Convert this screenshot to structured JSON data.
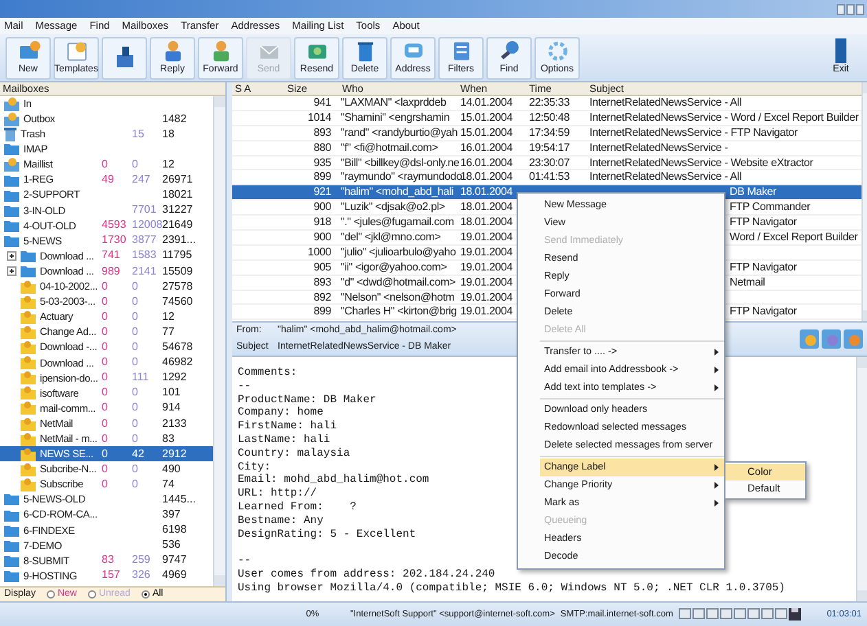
{
  "menu_bar": [
    "Mail",
    "Message",
    "Find",
    "Mailboxes",
    "Transfer",
    "Addresses",
    "Mailing List",
    "Tools",
    "About"
  ],
  "toolbar": [
    {
      "label": "New",
      "disabled": false
    },
    {
      "label": "Templates",
      "disabled": false
    },
    {
      "disabled": false
    },
    {
      "label": "Reply",
      "disabled": false
    },
    {
      "label": "Forward",
      "disabled": false
    },
    {
      "label": "Send",
      "disabled": true
    },
    {
      "label": "Resend",
      "disabled": false
    },
    {
      "label": "Delete",
      "disabled": false
    },
    {
      "label": "Address",
      "disabled": false
    },
    {
      "label": "Filters",
      "disabled": false
    },
    {
      "label": "Find",
      "disabled": false
    },
    {
      "label": "Options",
      "disabled": false
    }
  ],
  "exit_button": "Exit",
  "mailboxes": {
    "header": "Mailboxes",
    "items": [
      {
        "name": "In",
        "kind": "special",
        "selected": false
      },
      {
        "name": "Outbox",
        "kind": "special",
        "total": "1482",
        "selected": false
      },
      {
        "name": "Trash",
        "kind": "trash",
        "unread": "15",
        "total": "18",
        "selected": false
      },
      {
        "name": "IMAP",
        "kind": "folder",
        "selected": false
      },
      {
        "name": "Maillist",
        "kind": "special",
        "new": "0",
        "unread": "0",
        "total": "12",
        "selected": false
      },
      {
        "name": "1-REG",
        "kind": "folder",
        "new": "49",
        "unread": "247",
        "total": "26971",
        "selected": false
      },
      {
        "name": "2-SUPPORT",
        "kind": "folder",
        "total": "18021",
        "selected": false
      },
      {
        "name": "3-IN-OLD",
        "kind": "folder",
        "unread": "7701",
        "total": "31227",
        "selected": false
      },
      {
        "name": "4-OUT-OLD",
        "kind": "folder",
        "new": "4593",
        "unread": "12008",
        "total": "21649",
        "selected": false
      },
      {
        "name": "5-NEWS",
        "kind": "folder",
        "new": "1730",
        "unread": "3877",
        "total": "2391...",
        "selected": false,
        "children": [
          {
            "name": "Download ...",
            "kind": "folder",
            "new": "741",
            "unread": "1583",
            "total": "11795",
            "selected": false,
            "expanded": false
          },
          {
            "name": "Download ...",
            "kind": "folder",
            "new": "989",
            "unread": "2141",
            "total": "15509",
            "selected": false,
            "expanded": false
          },
          {
            "name": "04-10-2002...",
            "kind": "group",
            "new": "0",
            "unread": "0",
            "total": "27578",
            "selected": false
          },
          {
            "name": "5-03-2003-...",
            "kind": "group",
            "new": "0",
            "unread": "0",
            "total": "74560",
            "selected": false
          },
          {
            "name": "Actuary",
            "kind": "group",
            "new": "0",
            "unread": "0",
            "total": "12",
            "selected": false
          },
          {
            "name": "Change Ad...",
            "kind": "group",
            "new": "0",
            "unread": "0",
            "total": "77",
            "selected": false
          },
          {
            "name": "Download -...",
            "kind": "group",
            "new": "0",
            "unread": "0",
            "total": "54678",
            "selected": false
          },
          {
            "name": "Download ...",
            "kind": "group",
            "new": "0",
            "unread": "0",
            "total": "46982",
            "selected": false
          },
          {
            "name": "ipension-do...",
            "kind": "group",
            "new": "0",
            "unread": "111",
            "total": "1292",
            "selected": false
          },
          {
            "name": "isoftware",
            "kind": "group",
            "new": "0",
            "unread": "0",
            "total": "101",
            "selected": false
          },
          {
            "name": "mail-comm...",
            "kind": "group",
            "new": "0",
            "unread": "0",
            "total": "914",
            "selected": false
          },
          {
            "name": "NetMail",
            "kind": "group",
            "new": "0",
            "unread": "0",
            "total": "2133",
            "selected": false
          },
          {
            "name": "NetMail - m...",
            "kind": "group",
            "new": "0",
            "unread": "0",
            "total": "83",
            "selected": false
          },
          {
            "name": "NEWS SE...",
            "kind": "group",
            "new": "0",
            "unread": "42",
            "total": "2912",
            "selected": true
          },
          {
            "name": "Subcribe-N...",
            "kind": "group",
            "new": "0",
            "unread": "0",
            "total": "490",
            "selected": false
          },
          {
            "name": "Subscribe",
            "kind": "group",
            "new": "0",
            "unread": "0",
            "total": "74",
            "selected": false
          }
        ]
      },
      {
        "name": "5-NEWS-OLD",
        "kind": "folder",
        "total": "1445...",
        "selected": false
      },
      {
        "name": "6-CD-ROM-CA...",
        "kind": "folder",
        "total": "397",
        "selected": false
      },
      {
        "name": "6-FINDEXE",
        "kind": "folder",
        "total": "6198",
        "selected": false
      },
      {
        "name": "7-DEMO",
        "kind": "folder",
        "total": "536",
        "selected": false
      },
      {
        "name": "8-SUBMIT",
        "kind": "folder",
        "new": "83",
        "unread": "259",
        "total": "9747",
        "selected": false
      },
      {
        "name": "9-HOSTING",
        "kind": "folder",
        "new": "157",
        "unread": "326",
        "total": "4969",
        "selected": false
      }
    ]
  },
  "display": {
    "label": "Display",
    "options": [
      {
        "label": "New",
        "selected": false
      },
      {
        "label": "Unread",
        "selected": false
      },
      {
        "label": "All",
        "selected": true
      }
    ]
  },
  "messages": {
    "columns": [
      "S A",
      "Size",
      "Who",
      "When",
      "Time",
      "Subject"
    ],
    "rows": [
      {
        "size": "941",
        "who": "\"LAXMAN\" <laxprddeb",
        "when": "14.01.2004",
        "time": "22:35:33",
        "subject": "InternetRelatedNewsService - All",
        "selected": false
      },
      {
        "size": "1014",
        "who": "\"Shamini\" <engrshamin",
        "when": "15.01.2004",
        "time": "12:50:48",
        "subject": "InternetRelatedNewsService - Word / Excel Report Builder",
        "selected": false
      },
      {
        "size": "893",
        "who": "\"rand\" <randyburtio@yah",
        "when": "15.01.2004",
        "time": "17:34:59",
        "subject": "InternetRelatedNewsService - FTP Navigator",
        "selected": false
      },
      {
        "size": "880",
        "who": "\"f\" <fi@hotmail.com>",
        "when": "16.01.2004",
        "time": "19:54:17",
        "subject": "InternetRelatedNewsService -",
        "selected": false
      },
      {
        "size": "935",
        "who": "\"Bill\" <billkey@dsl-only.ne",
        "when": "16.01.2004",
        "time": "23:30:07",
        "subject": "InternetRelatedNewsService - Website eXtractor",
        "selected": false
      },
      {
        "size": "899",
        "who": "\"raymundo\" <raymundodo",
        "when": "18.01.2004",
        "time": "01:41:53",
        "subject": "InternetRelatedNewsService - All",
        "selected": false
      },
      {
        "size": "921",
        "who": "\"halim\" <mohd_abd_hali",
        "when": "18.01.2004",
        "subject": "DB Maker",
        "selected": true
      },
      {
        "size": "900",
        "who": "\"Luzik\" <djsak@o2.pl>",
        "when": "18.01.2004",
        "subject": "FTP Commander",
        "selected": false
      },
      {
        "size": "918",
        "who": "\".\" <jules@fugamail.com",
        "when": "18.01.2004",
        "subject": "FTP Navigator",
        "selected": false
      },
      {
        "size": "900",
        "who": "\"del\" <jkl@mno.com>",
        "when": "19.01.2004",
        "subject": "Word / Excel Report Builder",
        "selected": false
      },
      {
        "size": "1000",
        "who": "\"julio\" <julioarbulo@yaho",
        "when": "19.01.2004",
        "selected": false
      },
      {
        "size": "905",
        "who": "\"ii\" <igor@yahoo.com>",
        "when": "19.01.2004",
        "subject": "FTP Navigator",
        "selected": false
      },
      {
        "size": "893",
        "who": "\"d\" <dwd@hotmail.com>",
        "when": "19.01.2004",
        "subject": "Netmail",
        "selected": false
      },
      {
        "size": "892",
        "who": "\"Nelson\" <nelson@hotm",
        "when": "19.01.2004",
        "selected": false
      },
      {
        "size": "899",
        "who": "\"Charles H\" <kirton@brig",
        "when": "19.01.2004",
        "subject": "FTP Navigator",
        "selected": false
      }
    ]
  },
  "preview": {
    "from_label": "From:",
    "from": "\"halim\" <mohd_abd_halim@hotmail.com>",
    "subject_label": "Subject",
    "subject": "InternetRelatedNewsService - DB Maker",
    "body": [
      [
        "Comments:",
        "--",
        "ProductName: DB Maker",
        "Company: home",
        "FirstName: hali",
        "LastName: hali",
        "Country: malaysia",
        "City:",
        "Email: mohd_abd_halim@hot.com",
        "URL: http://",
        "Learned From:    ?",
        "Bestname: Any",
        "DesignRating: 5 - Excellent"
      ],
      [
        "--",
        "User comes from address: 202.184.24.240",
        "Using browser Mozilla/4.0 (compatible; MSIE 6.0; Windows NT 5.0; .NET CLR 1.0.3705)"
      ]
    ]
  },
  "context_menu": {
    "groups": [
      [
        {
          "label": "New Message",
          "disabled": false
        },
        {
          "label": "View",
          "disabled": false
        },
        {
          "label": "Send Immediately",
          "disabled": true
        },
        {
          "label": "Resend",
          "disabled": false
        },
        {
          "label": "Reply",
          "disabled": false
        },
        {
          "label": "Forward",
          "disabled": false
        },
        {
          "label": "Delete",
          "disabled": false
        },
        {
          "label": "Delete All",
          "disabled": true
        }
      ],
      [
        {
          "label": "Transfer to .... ->",
          "disabled": false,
          "submenu": true
        },
        {
          "label": "Add email into Addressbook ->",
          "disabled": false,
          "submenu": true
        },
        {
          "label": "Add text into templates ->",
          "disabled": false,
          "submenu": true
        }
      ],
      [
        {
          "label": "Download only headers",
          "disabled": false
        },
        {
          "label": "Redownload selected messages",
          "disabled": false
        },
        {
          "label": "Delete selected messages from server",
          "disabled": false
        }
      ],
      [
        {
          "label": "Change Label",
          "disabled": false,
          "submenu": true,
          "selected": true
        },
        {
          "label": "Change Priority",
          "disabled": false,
          "submenu": true
        },
        {
          "label": "Mark as",
          "disabled": false,
          "submenu": true
        },
        {
          "label": "Queueing",
          "disabled": true
        },
        {
          "label": "Headers",
          "disabled": false
        },
        {
          "label": "Decode",
          "disabled": false
        }
      ]
    ]
  },
  "submenu": [
    {
      "label": "Color",
      "selected": true
    },
    {
      "label": "Default",
      "selected": false
    }
  ],
  "status_bar": {
    "progress": "0%",
    "account": "\"InternetSoft Support\" <support@internet-soft.com>",
    "smtp": "SMTP:mail.internet-soft.com",
    "time": "01:03:01"
  }
}
